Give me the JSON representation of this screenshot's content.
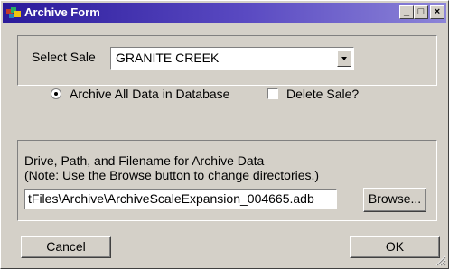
{
  "window": {
    "title": "Archive Form",
    "minimize": "_",
    "maximize": "□",
    "close": "×"
  },
  "sale": {
    "label": "Select Sale",
    "selected": "GRANITE CREEK"
  },
  "options": {
    "archive_all_label": "Archive All Data in Database",
    "archive_all_selected": true,
    "delete_sale_label": "Delete Sale?",
    "delete_sale_checked": false
  },
  "archive_path": {
    "line1": "Drive, Path, and Filename for Archive Data",
    "line2": "(Note:  Use the Browse button to change directories.)",
    "value": "tFiles\\Archive\\ArchiveScaleExpansion_004665.adb",
    "browse_label": "Browse..."
  },
  "footer": {
    "cancel_label": "Cancel",
    "ok_label": "OK"
  }
}
